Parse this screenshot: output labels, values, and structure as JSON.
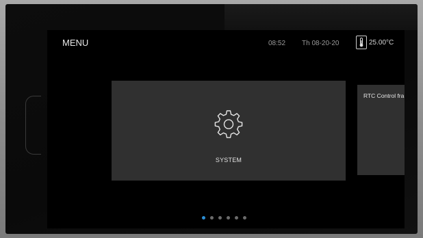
{
  "header": {
    "title": "MENU",
    "time": "08:52",
    "date": "Th 08-20-20",
    "temperature": "25.00°C",
    "temperature_icon": "thermometer-icon"
  },
  "cards": {
    "current": {
      "label": "SYSTEM",
      "icon": "gear-icon"
    },
    "next": {
      "label": "RTC Control fra"
    }
  },
  "pagination": {
    "total": 6,
    "active_index": 0,
    "active_color": "#2b8fd6",
    "inactive_color": "#6b6b6b"
  },
  "colors": {
    "screen_background": "#000000",
    "card_background": "#303030",
    "bezel": "#0d0d0d",
    "frame": "#9a9a9a"
  }
}
